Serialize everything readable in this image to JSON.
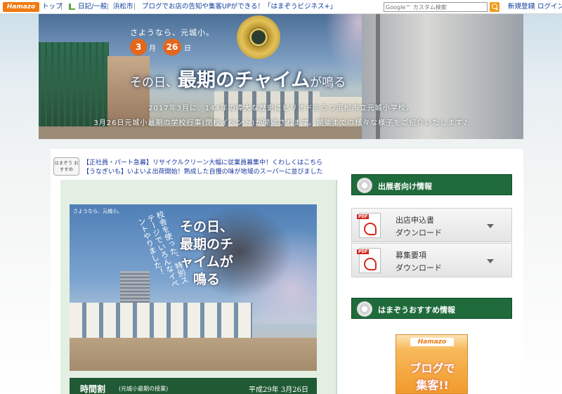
{
  "topbar": {
    "logo": "Hamazo",
    "nav": [
      {
        "label": "トップ"
      },
      {
        "label": "日記/一般"
      },
      {
        "label": "浜松市"
      },
      {
        "label": "ブログでお店の告知や集客UPができる！「はまぞうビジネス+」"
      }
    ],
    "separator": "|",
    "search_placeholder": "Google™ カスタム検索",
    "register": "新規登録",
    "login": "ログイン"
  },
  "hero": {
    "farewell": "さようなら、元城小。",
    "month": "3",
    "month_unit": "月",
    "day": "26",
    "day_unit": "日",
    "title_a": "その日、",
    "title_b": "最期のチャイム",
    "title_c": "が鳴る",
    "line1": "2017年3月に、144年の偉大な歴史にピリオドをうつ浜松市立元城小学校。",
    "line2": "3月26日元城小最期の学校行事(閉校イベント)が開催されます。開催までの様々な様子をご紹介いたします♪"
  },
  "news": {
    "badge": "はまぞう おすすめ",
    "items": [
      "【正社員・パート急募】リサイクルクリーン大幅に従業員募集中！くわしくはこちら",
      "【うなぎいも】いよいよ出荷開始！熟成した自慢の味が地域のスーパーに並びました"
    ]
  },
  "poster": {
    "tag": "さようなら、元城小。",
    "vtext": "校舎を使った、特別ステージでいろんなイベントやりました！",
    "title": "その日、最期のチャイムが鳴る"
  },
  "schedule": {
    "title": "時間割",
    "subtitle": "(元城小最期の授業)",
    "date": "平成29年 3月26日"
  },
  "sidebar": {
    "exhibitor_title": "出展者向け情報",
    "downloads": [
      {
        "line1": "出店申込書",
        "line2": "ダウンロード"
      },
      {
        "line1": "募集要項",
        "line2": "ダウンロード"
      }
    ],
    "pdf_label": "PDF",
    "recommend_title": "はまぞうおすすめ情報"
  },
  "banner": {
    "logo": "Hamazo",
    "text1": "ブログで",
    "text2": "集客!!"
  }
}
